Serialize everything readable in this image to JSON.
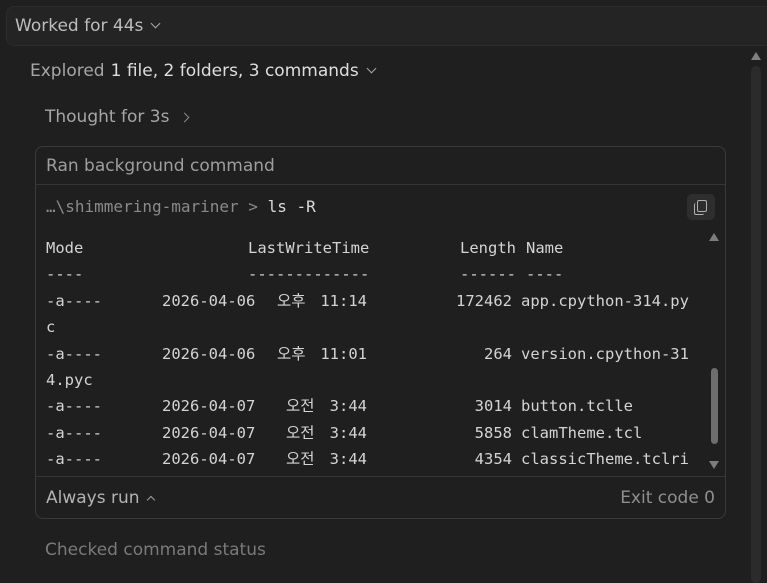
{
  "header": {
    "worked_label": "Worked for 44s"
  },
  "explored": {
    "prefix": "Explored",
    "summary": "1 file, 2 folders, 3 commands"
  },
  "thought": {
    "label": "Thought for 3s"
  },
  "command_card": {
    "title": "Ran background command",
    "path": "…\\shimmering-mariner",
    "prompt_symbol": ">",
    "command": "ls -R",
    "copy_icon": "copy-icon",
    "columns": [
      "Mode",
      "LastWriteTime",
      "Length",
      "Name"
    ],
    "underlines": [
      "----",
      "-------------",
      "------",
      "----"
    ],
    "rows": [
      {
        "mode": "-a----",
        "date": "2026-04-06",
        "ampm": "오후",
        "time": "11:14",
        "length": "172462",
        "name": "app.cpython-314.py",
        "wrap": "c"
      },
      {
        "mode": "-a----",
        "date": "2026-04-06",
        "ampm": "오후",
        "time": "11:01",
        "length": "264",
        "name": "version.cpython-31",
        "wrap": "4.pyc"
      },
      {
        "mode": "-a----",
        "date": "2026-04-07",
        "ampm": "오전",
        "time": "3:44",
        "length": "3014",
        "name": "button.tclle",
        "wrap": ""
      },
      {
        "mode": "-a----",
        "date": "2026-04-07",
        "ampm": "오전",
        "time": "3:44",
        "length": "5858",
        "name": "clamTheme.tcl",
        "wrap": ""
      },
      {
        "mode": "-a----",
        "date": "2026-04-07",
        "ampm": "오전",
        "time": "3:44",
        "length": "4354",
        "name": "classicTheme.tclri",
        "wrap": ""
      }
    ],
    "footer": {
      "always_run_label": "Always run",
      "exit_code_label": "Exit code 0"
    }
  },
  "checked": {
    "label": "Checked command status"
  },
  "colors": {
    "background": "#1f1f1f",
    "card_border": "#3a3a3a",
    "text_primary": "#d4d4d4",
    "text_muted": "#8a8a8a"
  }
}
